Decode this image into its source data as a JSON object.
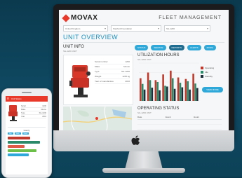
{
  "brand": {
    "name": "MOVAX",
    "accent": "#e8392b",
    "primary": "#2ea8d8"
  },
  "app_title": "FLEET MANAGEMENT",
  "filters": [
    {
      "value": "United Kingdom"
    },
    {
      "value": "Stanford Foundation"
    },
    {
      "value": "SG-1200"
    }
  ],
  "page_title": "UNIT OVERVIEW",
  "unit_info": {
    "title": "UNIT INFO",
    "subtitle": "SG-1200 UNIT",
    "specs": [
      {
        "label": "Serial number",
        "value": "1200"
      },
      {
        "label": "Make",
        "value": "Movax"
      },
      {
        "label": "Type",
        "value": "SG-1200"
      },
      {
        "label": "Weight",
        "value": "1245 kg"
      },
      {
        "label": "Year of manufacture",
        "value": "2016"
      }
    ]
  },
  "action_buttons": [
    {
      "label": "STATUS"
    },
    {
      "label": "SERVICE"
    },
    {
      "label": "REPORTS"
    },
    {
      "label": "ALERTS"
    },
    {
      "label": "MORE"
    }
  ],
  "utilization": {
    "title": "UTILIZATION HOURS",
    "subtitle": "SG-1200 UNIT",
    "legend": [
      {
        "label": "Operating",
        "color": "#c0392b"
      },
      {
        "label": "Idle",
        "color": "#2a8a6a"
      },
      {
        "label": "Standby",
        "color": "#1f2f3a"
      }
    ],
    "view_button": "VIEW MORE"
  },
  "chart_data": {
    "type": "bar",
    "categories": [
      "1",
      "2",
      "3",
      "4",
      "5",
      "6",
      "7",
      "8"
    ],
    "series": [
      {
        "name": "Operating",
        "values": [
          60,
          75,
          55,
          70,
          80,
          62,
          58,
          72
        ]
      },
      {
        "name": "Idle",
        "values": [
          45,
          55,
          50,
          40,
          60,
          48,
          52,
          46
        ]
      },
      {
        "name": "Standby",
        "values": [
          30,
          35,
          28,
          38,
          32,
          36,
          30,
          34
        ]
      }
    ],
    "ylim": [
      0,
      100
    ]
  },
  "operating_status": {
    "title": "OPERATING STATUS",
    "subtitle": "SG-1200 UNIT",
    "columns": [
      "Date",
      "Event",
      "Hours"
    ],
    "rows": [
      {
        "date": "",
        "event": "",
        "hours": ""
      },
      {
        "date": "",
        "event": "",
        "hours": ""
      }
    ]
  },
  "phone": {
    "title": "Unit Status",
    "specs": [
      {
        "label": "Serial",
        "value": "1200"
      },
      {
        "label": "Make",
        "value": "Movax"
      },
      {
        "label": "Type",
        "value": "SG-1200"
      },
      {
        "label": "Year",
        "value": "2016"
      }
    ],
    "chart_title": "Hourly",
    "tabs": [
      "Day",
      "Week",
      "Month"
    ],
    "bars": [
      {
        "fraction": 0.6,
        "color": "#c0392b"
      },
      {
        "fraction": 0.85,
        "color": "#2a8a6a"
      },
      {
        "fraction": 0.45,
        "color": "#e05a48"
      },
      {
        "fraction": 0.75,
        "color": "#6cc04a"
      },
      {
        "fraction": 0.55,
        "color": "#2ea8d8"
      }
    ]
  }
}
